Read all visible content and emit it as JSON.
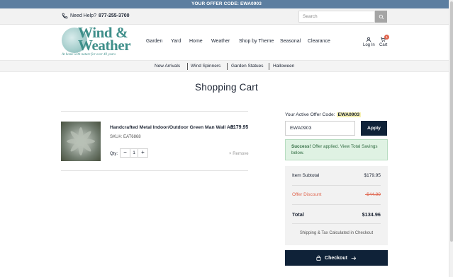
{
  "promo_bar": {
    "text": "YOUR OFFER CODE: EWA0903"
  },
  "utility": {
    "help_label": "Need Help?",
    "phone": "877-255-3700",
    "search_placeholder": "Search"
  },
  "logo": {
    "line1": "Wind &",
    "line2": "Weather",
    "tagline": "At home with nature for over 40 years"
  },
  "nav": {
    "items": [
      "Garden",
      "Yard",
      "Home",
      "Weather",
      "Shop by Theme",
      "Seasonal",
      "Clearance"
    ]
  },
  "header_icons": {
    "login_label": "Log In",
    "cart_label": "Cart",
    "cart_count": "1"
  },
  "sub_nav": {
    "items": [
      "New Arrivals",
      "Wind Spinners",
      "Garden Statues",
      "Halloween"
    ]
  },
  "page": {
    "title": "Shopping Cart"
  },
  "cart_item": {
    "name": "Handcrafted Metal Indoor/Outdoor Green Man Wall Art",
    "price": "$179.95",
    "sku_label": "SKU#:",
    "sku": "EAT6868",
    "qty_label": "Qty:",
    "qty_value": "1",
    "remove_label": "Remove"
  },
  "offer": {
    "label": "Your Active Offer Code:",
    "code": "EWA0903",
    "input_value": "EWA0903",
    "apply_label": "Apply",
    "success_strong": "Success!",
    "success_text": "Offer applied. View Total Savings below."
  },
  "summary": {
    "subtotal_label": "Item Subtotal",
    "subtotal_value": "$179.95",
    "discount_label": "Offer Discount",
    "discount_value": "-$44.99",
    "total_label": "Total",
    "total_value": "$134.96",
    "shipping_note": "Shipping & Tax Calculated in Checkout"
  },
  "checkout": {
    "label": "Checkout"
  },
  "colors": {
    "promo_bar": "#5c7ea0",
    "navy": "#0f2238",
    "brand_teal": "#3f8f8a",
    "discount_red": "#e0664f",
    "success_green_bg": "#dff2e3",
    "offer_highlight": "#f7f1b3"
  }
}
